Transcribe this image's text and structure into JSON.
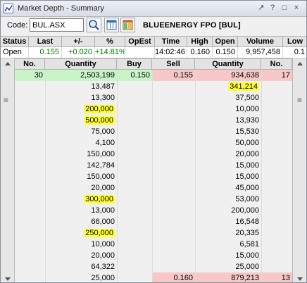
{
  "window": {
    "title": "Market Depth - Summary",
    "controls": [
      "↗",
      "?",
      "□",
      "×"
    ]
  },
  "toolbar": {
    "code_label": "Code:",
    "code_value": "BUL.ASX",
    "security_name": "BLUEENERGY FPO [BUL]"
  },
  "summary": {
    "headers": [
      "Status",
      "Last",
      "+/-",
      "%",
      "OpEst",
      "Time",
      "High",
      "Open",
      "Volume",
      "Low"
    ],
    "values": {
      "status": "Open",
      "last": "0.155",
      "change": "+0.020",
      "pct": "+14.81%",
      "opest": "",
      "time": "14:02:46",
      "high": "0.160",
      "open": "0.150",
      "volume": "9,957,458",
      "low": "0.1"
    }
  },
  "depth": {
    "headers": {
      "bid_no": "No.",
      "bid_qty": "Quantity",
      "buy": "Buy",
      "sell": "Sell",
      "ask_qty": "Quantity",
      "ask_no": "No."
    },
    "rows": [
      {
        "bid_no": "30",
        "bid_qty": "2,503,199",
        "buy": "0.150",
        "sell": "0.155",
        "ask_qty": "934,638",
        "ask_no": "17",
        "bid_hl": false,
        "ask_hl": false,
        "best": true
      },
      {
        "bid_no": "",
        "bid_qty": "13,487",
        "buy": "",
        "sell": "",
        "ask_qty": "341,214",
        "ask_no": "",
        "bid_hl": false,
        "ask_hl": true
      },
      {
        "bid_no": "",
        "bid_qty": "13,300",
        "buy": "",
        "sell": "",
        "ask_qty": "37,500",
        "ask_no": "",
        "bid_hl": false,
        "ask_hl": false
      },
      {
        "bid_no": "",
        "bid_qty": "200,000",
        "buy": "",
        "sell": "",
        "ask_qty": "10,000",
        "ask_no": "",
        "bid_hl": true,
        "ask_hl": false
      },
      {
        "bid_no": "",
        "bid_qty": "500,000",
        "buy": "",
        "sell": "",
        "ask_qty": "13,930",
        "ask_no": "",
        "bid_hl": true,
        "ask_hl": false
      },
      {
        "bid_no": "",
        "bid_qty": "75,000",
        "buy": "",
        "sell": "",
        "ask_qty": "15,530",
        "ask_no": "",
        "bid_hl": false,
        "ask_hl": false
      },
      {
        "bid_no": "",
        "bid_qty": "4,100",
        "buy": "",
        "sell": "",
        "ask_qty": "50,000",
        "ask_no": "",
        "bid_hl": false,
        "ask_hl": false
      },
      {
        "bid_no": "",
        "bid_qty": "150,000",
        "buy": "",
        "sell": "",
        "ask_qty": "20,000",
        "ask_no": "",
        "bid_hl": false,
        "ask_hl": false
      },
      {
        "bid_no": "",
        "bid_qty": "142,784",
        "buy": "",
        "sell": "",
        "ask_qty": "15,000",
        "ask_no": "",
        "bid_hl": false,
        "ask_hl": false
      },
      {
        "bid_no": "",
        "bid_qty": "150,000",
        "buy": "",
        "sell": "",
        "ask_qty": "15,000",
        "ask_no": "",
        "bid_hl": false,
        "ask_hl": false
      },
      {
        "bid_no": "",
        "bid_qty": "20,000",
        "buy": "",
        "sell": "",
        "ask_qty": "45,000",
        "ask_no": "",
        "bid_hl": false,
        "ask_hl": false
      },
      {
        "bid_no": "",
        "bid_qty": "300,000",
        "buy": "",
        "sell": "",
        "ask_qty": "53,000",
        "ask_no": "",
        "bid_hl": true,
        "ask_hl": false
      },
      {
        "bid_no": "",
        "bid_qty": "13,000",
        "buy": "",
        "sell": "",
        "ask_qty": "200,000",
        "ask_no": "",
        "bid_hl": false,
        "ask_hl": false
      },
      {
        "bid_no": "",
        "bid_qty": "66,000",
        "buy": "",
        "sell": "",
        "ask_qty": "16,548",
        "ask_no": "",
        "bid_hl": false,
        "ask_hl": false
      },
      {
        "bid_no": "",
        "bid_qty": "250,000",
        "buy": "",
        "sell": "",
        "ask_qty": "20,335",
        "ask_no": "",
        "bid_hl": true,
        "ask_hl": false
      },
      {
        "bid_no": "",
        "bid_qty": "10,000",
        "buy": "",
        "sell": "",
        "ask_qty": "6,581",
        "ask_no": "",
        "bid_hl": false,
        "ask_hl": false
      },
      {
        "bid_no": "",
        "bid_qty": "20,000",
        "buy": "",
        "sell": "",
        "ask_qty": "15,000",
        "ask_no": "",
        "bid_hl": false,
        "ask_hl": false
      },
      {
        "bid_no": "",
        "bid_qty": "64,322",
        "buy": "",
        "sell": "",
        "ask_qty": "25,000",
        "ask_no": "",
        "bid_hl": false,
        "ask_hl": false
      },
      {
        "bid_no": "",
        "bid_qty": "25,000",
        "buy": "",
        "sell": "0.160",
        "ask_qty": "879,213",
        "ask_no": "13",
        "bid_hl": false,
        "ask_hl": false,
        "ask_level": true
      }
    ]
  },
  "colors": {
    "highlight": "#ffff33",
    "bid_best": "#c8f5c8",
    "ask_best": "#f8c8c8",
    "positive": "#008000"
  }
}
